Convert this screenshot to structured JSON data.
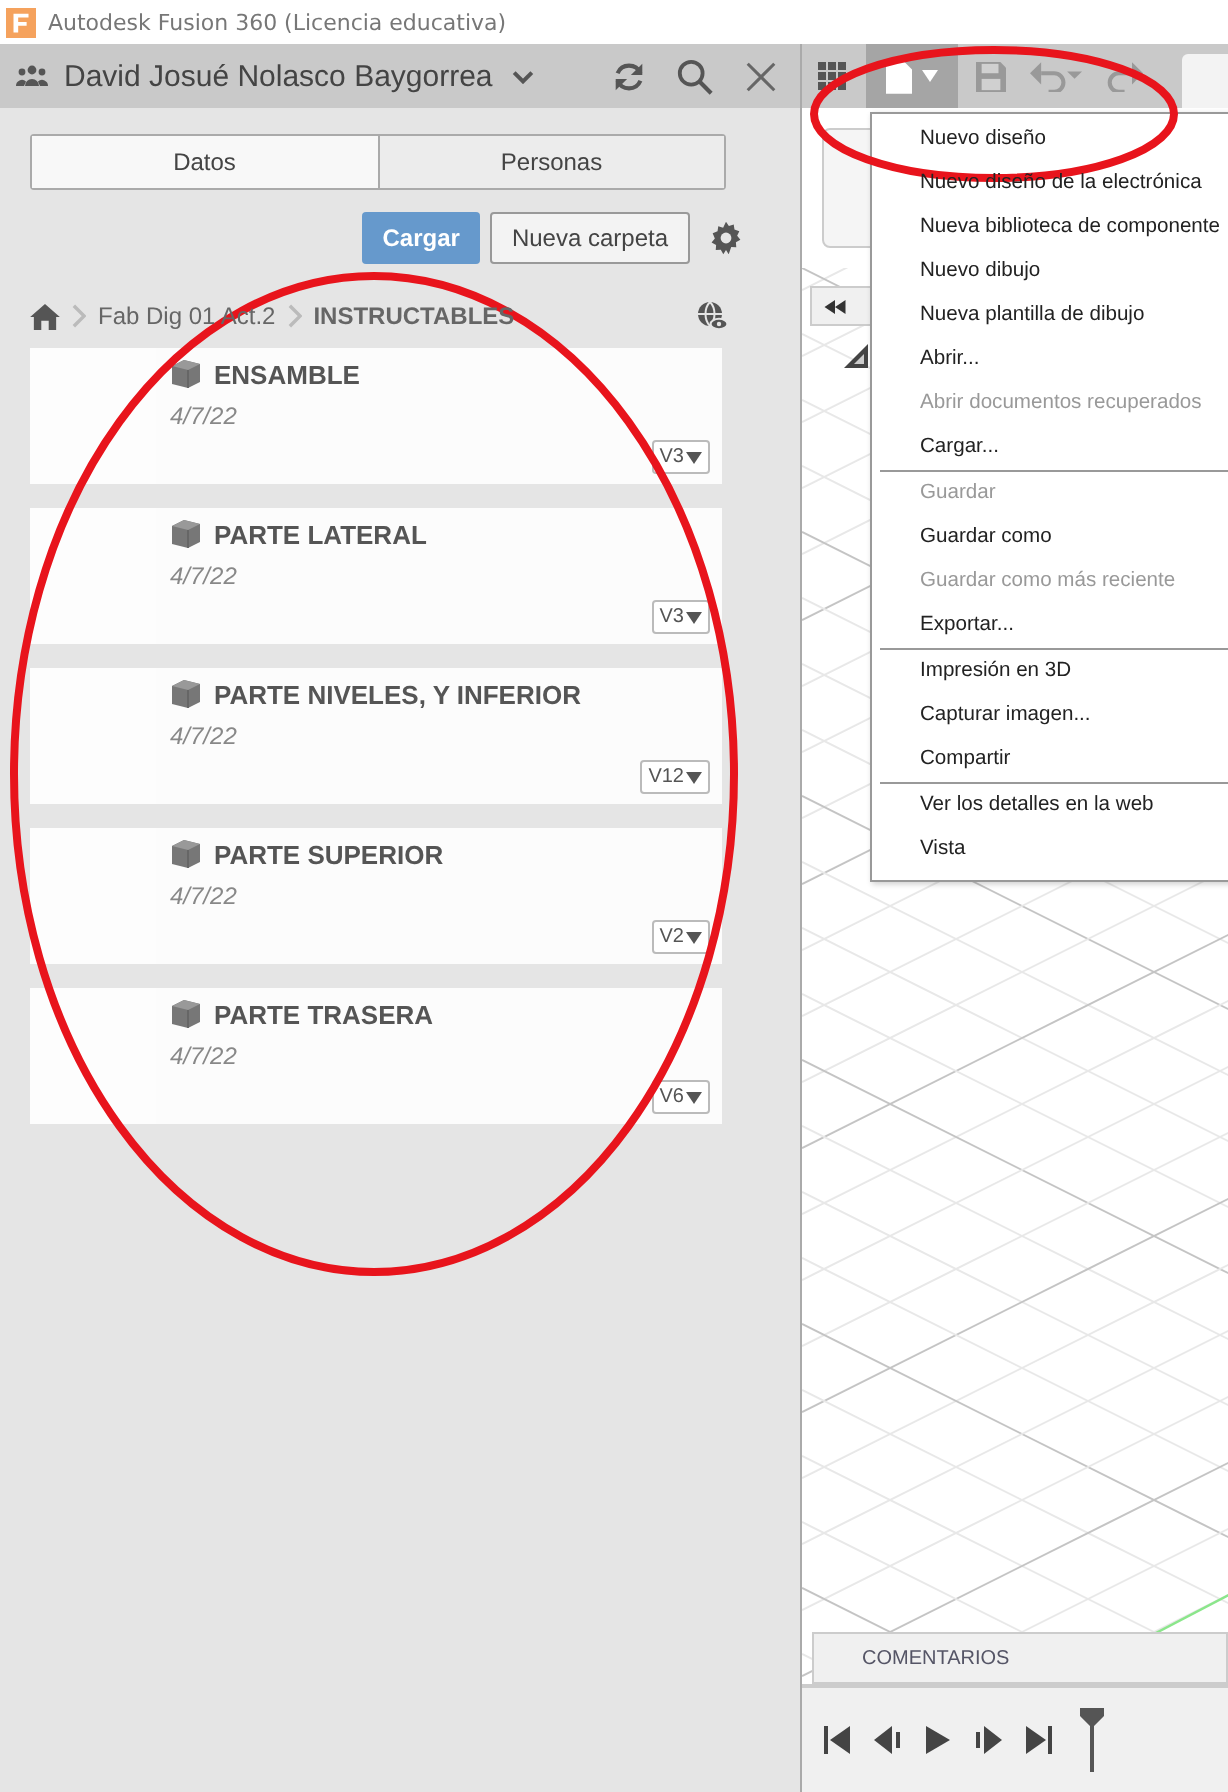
{
  "window": {
    "title": "Autodesk Fusion 360 (Licencia educativa)"
  },
  "data_panel": {
    "user": "David Josué Nolasco Baygorrea",
    "tabs": [
      {
        "label": "Datos",
        "selected": true
      },
      {
        "label": "Personas",
        "selected": false
      }
    ],
    "buttons": [
      {
        "label": "Cargar",
        "kind": "primary"
      },
      {
        "label": "Nueva carpeta",
        "kind": "secondary"
      }
    ],
    "breadcrumb": [
      "Fab Dig 01 Act.2",
      "INSTRUCTABLES"
    ],
    "files": [
      {
        "name": "ENSAMBLE",
        "date": "4/7/22",
        "version": "V3"
      },
      {
        "name": "PARTE LATERAL",
        "date": "4/7/22",
        "version": "V3"
      },
      {
        "name": "PARTE NIVELES, Y INFERIOR",
        "date": "4/7/22",
        "version": "V12"
      },
      {
        "name": "PARTE SUPERIOR",
        "date": "4/7/22",
        "version": "V2"
      },
      {
        "name": "PARTE TRASERA",
        "date": "4/7/22",
        "version": "V6"
      }
    ]
  },
  "file_menu": {
    "groups": [
      [
        {
          "label": "Nuevo diseño",
          "disabled": false
        },
        {
          "label": "Nuevo diseño de la electrónica",
          "disabled": false
        },
        {
          "label": "Nueva biblioteca de componente",
          "disabled": false
        },
        {
          "label": "Nuevo dibujo",
          "disabled": false
        },
        {
          "label": "Nueva plantilla de dibujo",
          "disabled": false
        },
        {
          "label": "Abrir...",
          "disabled": false
        },
        {
          "label": "Abrir documentos recuperados",
          "disabled": true
        },
        {
          "label": "Cargar...",
          "disabled": false
        }
      ],
      [
        {
          "label": "Guardar",
          "disabled": true
        },
        {
          "label": "Guardar como",
          "disabled": false
        },
        {
          "label": "Guardar como más reciente",
          "disabled": true
        },
        {
          "label": "Exportar...",
          "disabled": false
        }
      ],
      [
        {
          "label": "Impresión en 3D",
          "disabled": false
        },
        {
          "label": "Capturar imagen...",
          "disabled": false
        },
        {
          "label": "Compartir",
          "disabled": false
        }
      ],
      [
        {
          "label": "Ver los detalles en la web",
          "disabled": false
        },
        {
          "label": "Vista",
          "disabled": false
        }
      ]
    ]
  },
  "comments_bar": {
    "label": "COMENTARIOS"
  },
  "annotations": [
    {
      "kind": "ellipse"
    },
    {
      "kind": "ellipse"
    }
  ]
}
